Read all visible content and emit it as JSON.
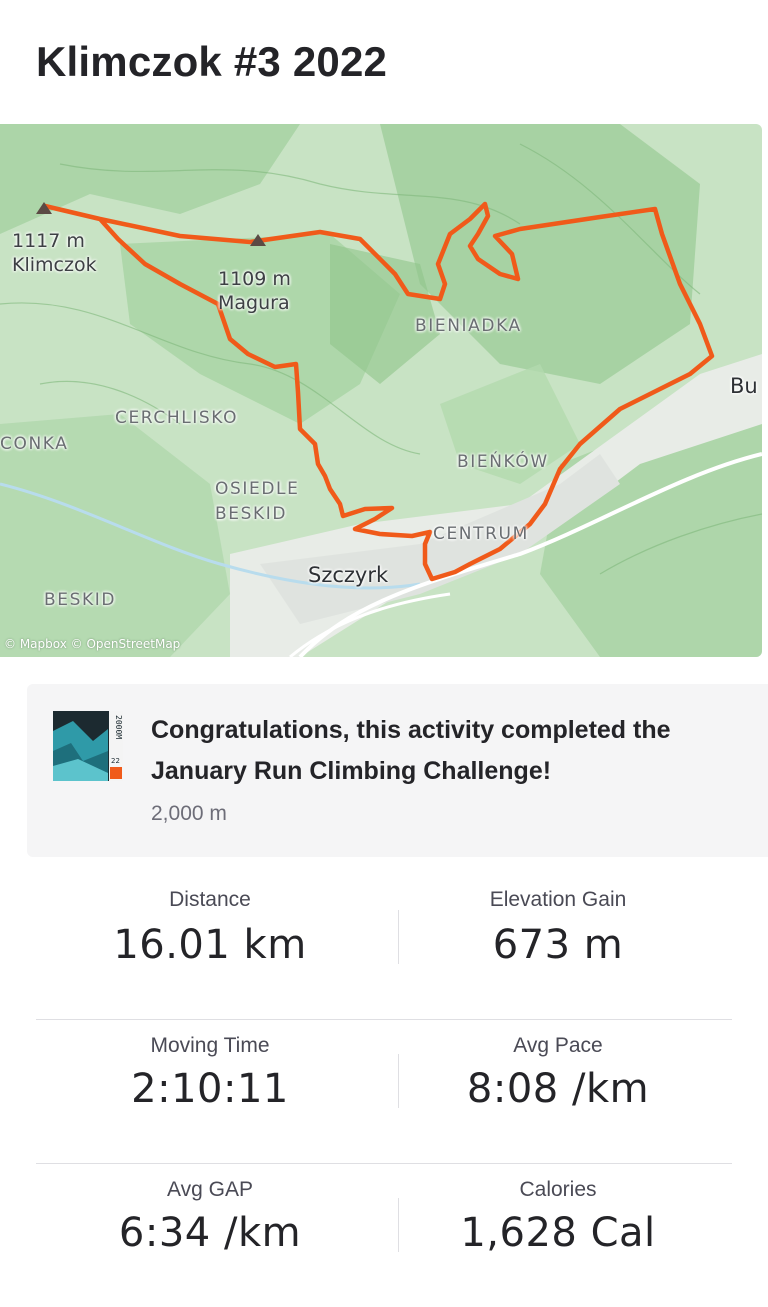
{
  "activity": {
    "title": "Klimczok #3 2022"
  },
  "map": {
    "peaks": [
      {
        "label": "1117 m\nKlimczok",
        "icon": "mountain-peak-icon"
      },
      {
        "label": "1109 m\nMagura",
        "icon": "mountain-peak-icon"
      }
    ],
    "labels": [
      "BIENIADKA",
      "CERCHLISKO",
      "CONKA",
      "BIEŃKÓW",
      "OSIEDLE\nBESKID",
      "CENTRUM",
      "BESKID"
    ],
    "towns": [
      "Szczyrk",
      "Bu"
    ],
    "attribution": "© Mapbox © OpenStreetMap",
    "route_color": "#f05a1a"
  },
  "challenge": {
    "message": "Congratulations, this activity completed the January Run Climbing Challenge!",
    "goal": "2,000 m",
    "badge_text": "2000M",
    "badge_year": "22"
  },
  "stats": [
    [
      {
        "label": "Distance",
        "value": "16.01 km"
      },
      {
        "label": "Elevation Gain",
        "value": "673 m"
      }
    ],
    [
      {
        "label": "Moving Time",
        "value": "2:10:11"
      },
      {
        "label": "Avg Pace",
        "value": "8:08 /km"
      }
    ],
    [
      {
        "label": "Avg GAP",
        "value": "6:34 /km"
      },
      {
        "label": "Calories",
        "value": "1,628 Cal"
      }
    ]
  ]
}
